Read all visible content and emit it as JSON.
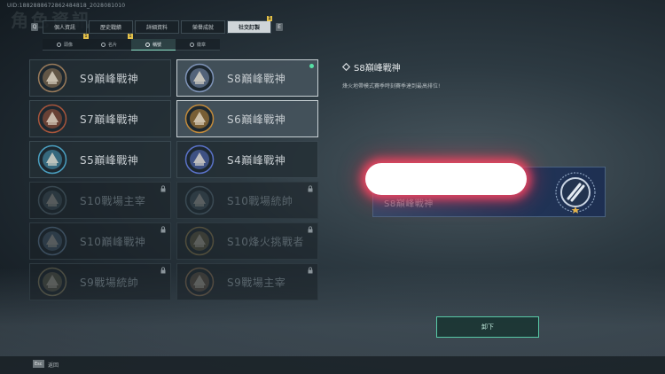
{
  "uid": "UID:1882888672862484818_2028081010",
  "bg_title": "角色資訊",
  "main_tabs": [
    {
      "label": "個人資訊",
      "active": false,
      "badge": ""
    },
    {
      "label": "歷史戰績",
      "active": false,
      "badge": ""
    },
    {
      "label": "詳細資料",
      "active": false,
      "badge": ""
    },
    {
      "label": "榮譽成就",
      "active": false,
      "badge": ""
    },
    {
      "label": "社交訂製",
      "active": true,
      "badge": "1"
    }
  ],
  "key_hints": {
    "left": "Q",
    "right": "E"
  },
  "sub_tabs": [
    {
      "label": "頭像",
      "active": false,
      "badge": "1"
    },
    {
      "label": "名片",
      "active": false,
      "badge": "1"
    },
    {
      "label": "稱號",
      "active": true,
      "badge": ""
    },
    {
      "label": "徽章",
      "active": false,
      "badge": ""
    }
  ],
  "cards": [
    {
      "name": "S9巔峰戰神",
      "state": "normal",
      "emblem": "s9-emblem-icon",
      "color": "#9a7b5a"
    },
    {
      "name": "S8巔峰戰神",
      "state": "selected",
      "emblem": "s8-emblem-icon",
      "color": "#7f94b8"
    },
    {
      "name": "S7巔峰戰神",
      "state": "normal",
      "emblem": "s7-emblem-icon",
      "color": "#a8553b"
    },
    {
      "name": "S6巔峰戰神",
      "state": "selected",
      "emblem": "s6-emblem-icon",
      "color": "#c28a3a"
    },
    {
      "name": "S5巔峰戰神",
      "state": "normal",
      "emblem": "s5-emblem-icon",
      "color": "#4a9fc0"
    },
    {
      "name": "S4巔峰戰神",
      "state": "normal",
      "emblem": "s4-emblem-icon",
      "color": "#5a72c8"
    },
    {
      "name": "S10戰場主宰",
      "state": "locked",
      "emblem": "s10-master-emblem-icon",
      "color": "#6c8796"
    },
    {
      "name": "S10戰場統帥",
      "state": "locked",
      "emblem": "s10-commander-emblem-icon",
      "color": "#6c8796"
    },
    {
      "name": "S10巔峰戰神",
      "state": "locked",
      "emblem": "s10-peak-emblem-icon",
      "color": "#7b9fc3"
    },
    {
      "name": "S10烽火挑戰者",
      "state": "locked",
      "emblem": "s10-challenger-emblem-icon",
      "color": "#b09555"
    },
    {
      "name": "S9戰場統帥",
      "state": "locked",
      "emblem": "s9-commander-emblem-icon",
      "color": "#a59a70"
    },
    {
      "name": "S9戰場主宰",
      "state": "locked",
      "emblem": "s9-master-emblem-icon",
      "color": "#b08960"
    }
  ],
  "detail": {
    "title": "S8巔峰戰神",
    "description": "烽火地帶模式賽季時刻賽季達到最高排位!",
    "banner_name": "S8巔峰戰神"
  },
  "equip_button": "卸下",
  "footer": {
    "esc_key": "Esc",
    "esc_label": "返回"
  },
  "colors": {
    "accent": "#58c9a6",
    "new_dot": "#56e0a5",
    "badge": "#e3c14a"
  }
}
